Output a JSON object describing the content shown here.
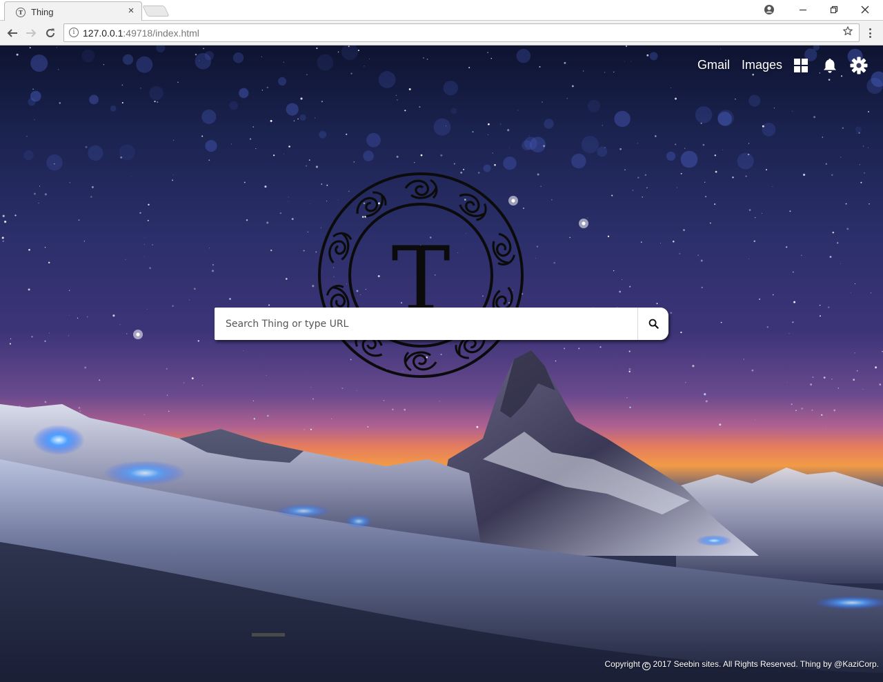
{
  "browser": {
    "tab_title": "Thing",
    "tab_close": "×",
    "favicon_letter": "T",
    "url_host": "127.0.0.1",
    "url_rest": ":49718/index.html",
    "info_icon": "i"
  },
  "header": {
    "gmail_label": "Gmail",
    "images_label": "Images",
    "icons": [
      "apps-grid-icon",
      "bell-icon",
      "gear-icon"
    ]
  },
  "logo": {
    "letter": "T"
  },
  "search": {
    "placeholder": "Search Thing or type URL",
    "value": "",
    "icon": "search-icon"
  },
  "footer": {
    "before": "Copyright ",
    "copy_symbol": "C",
    "after": " 2017 Seebin sites. All Rights Reserved. Thing by @KaziCorp."
  },
  "colors": {
    "sky_top": "#0e1330",
    "horizon_orange": "#f29a46",
    "horizon_pink": "#b16290",
    "text_white": "#ffffff"
  }
}
